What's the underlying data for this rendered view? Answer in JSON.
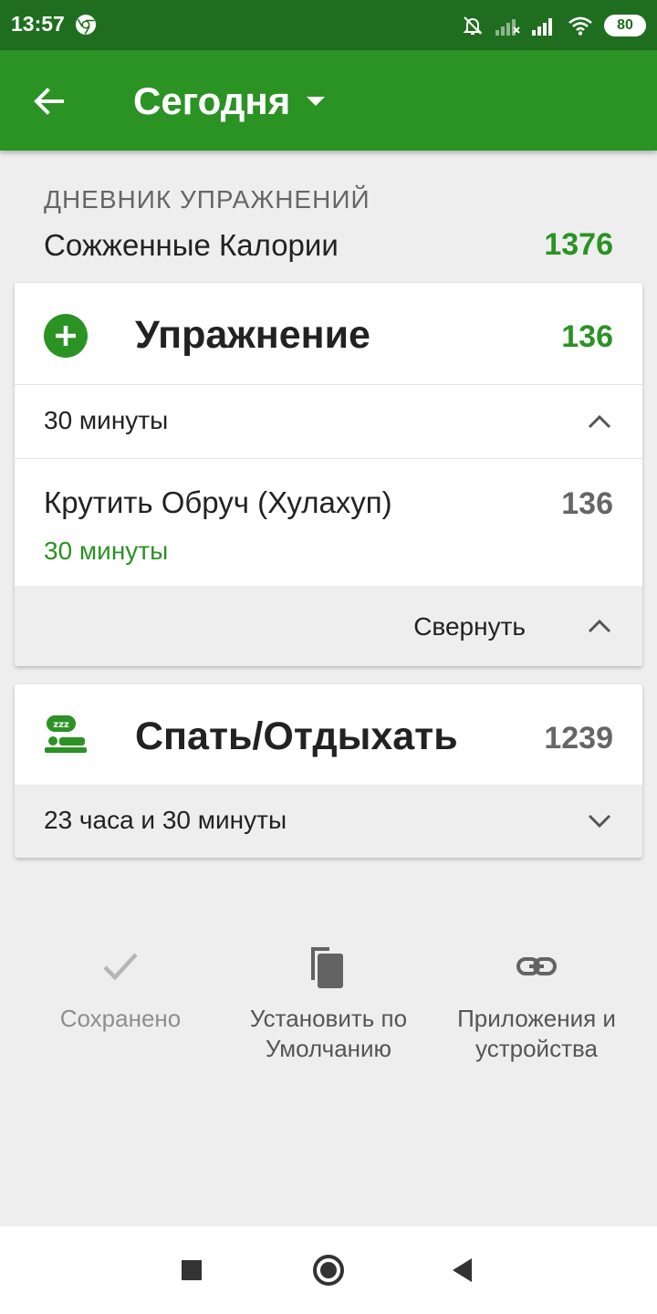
{
  "status_bar": {
    "time": "13:57",
    "battery": "80",
    "icons": [
      "chrome-icon",
      "bell-off-icon",
      "signal-weak-icon",
      "signal-icon",
      "wifi-icon",
      "battery-icon"
    ]
  },
  "app_bar": {
    "back_icon": "arrow-left-icon",
    "title": "Сегодня",
    "dropdown_icon": "caret-down-icon"
  },
  "summary": {
    "section_label": "ДНЕВНИК УПРАЖНЕНИЙ",
    "label": "Сожженные Калории",
    "value": "1376"
  },
  "exercise_card": {
    "icon": "plus-circle-icon",
    "title": "Упражнение",
    "value": "136",
    "duration": "30 минуты",
    "items": [
      {
        "name": "Крутить Обруч (Хулахуп)",
        "duration": "30 минуты",
        "calories": "136"
      }
    ],
    "collapse_label": "Свернуть"
  },
  "sleep_card": {
    "icon": "sleep-icon",
    "title": "Спать/Отдыхать",
    "value": "1239",
    "duration": "23 часа и 30 минуты"
  },
  "actions": [
    {
      "icon": "checkmark-icon",
      "label": "Сохранено",
      "enabled": false
    },
    {
      "icon": "copy-icon",
      "label": "Установить по Умолчанию",
      "enabled": true
    },
    {
      "icon": "link-icon",
      "label": "Приложения и устройства",
      "enabled": true
    }
  ],
  "nav_bar": {
    "icons": [
      "recents-square-icon",
      "home-circle-icon",
      "back-triangle-icon"
    ]
  },
  "colors": {
    "accent": "#2b9224",
    "status_bar": "#1f6e1f",
    "background": "#efeeef"
  }
}
